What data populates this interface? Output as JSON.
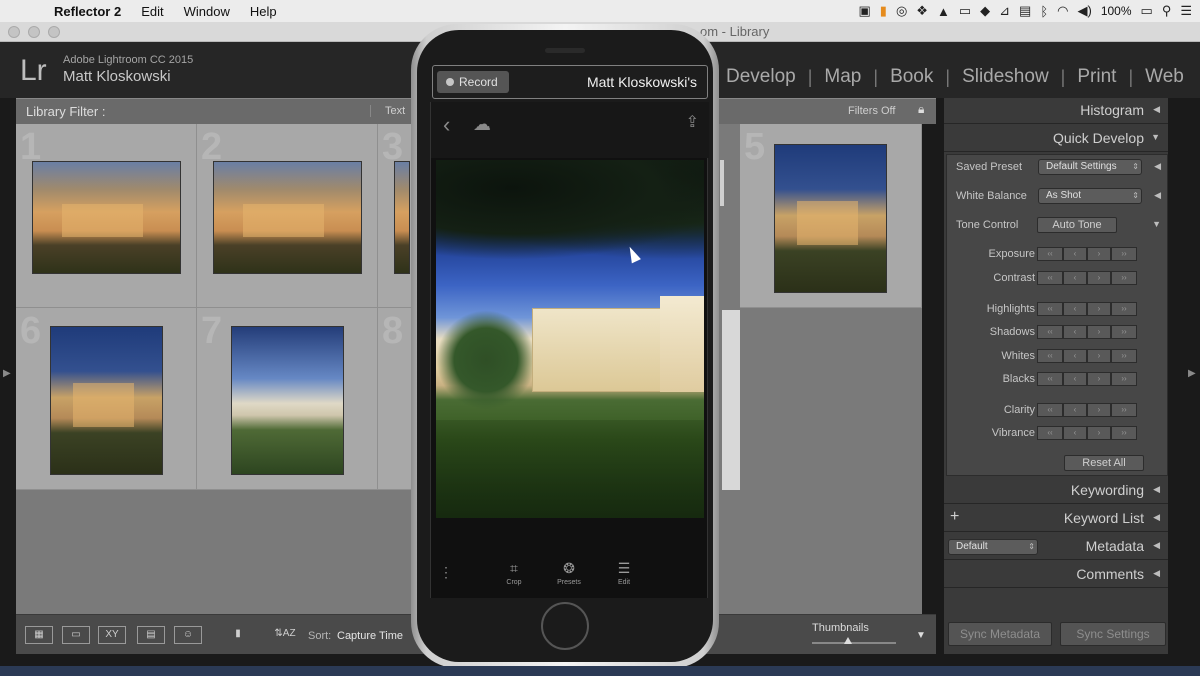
{
  "menubar": {
    "app": "Reflector 2",
    "menus": [
      "Edit",
      "Window",
      "Help"
    ],
    "battery": "100%"
  },
  "window": {
    "title": "om - Library"
  },
  "lightroom": {
    "logo": "Lr",
    "product": "Adobe Lightroom CC 2015",
    "user": "Matt Kloskowski",
    "modules": [
      "Develop",
      "Map",
      "Book",
      "Slideshow",
      "Print",
      "Web"
    ]
  },
  "filter": {
    "label": "Library Filter :",
    "text_tab": "Text",
    "filters_off": "Filters Off"
  },
  "grid": {
    "cell_numbers": [
      "1",
      "2",
      "3",
      "5",
      "6",
      "7",
      "8"
    ]
  },
  "toolbar": {
    "sort_label": "Sort:",
    "sort_value": "Capture Time",
    "thumbnails_label": "Thumbnails",
    "thumbnail_size": 0.45
  },
  "panel": {
    "histogram": "Histogram",
    "quick_develop": "Quick Develop",
    "saved_preset_label": "Saved Preset",
    "saved_preset_value": "Default Settings",
    "white_balance_label": "White Balance",
    "white_balance_value": "As Shot",
    "tone_control_label": "Tone Control",
    "auto_tone": "Auto Tone",
    "adjustments": [
      "Exposure",
      "Contrast",
      "Highlights",
      "Shadows",
      "Whites",
      "Blacks",
      "Clarity",
      "Vibrance"
    ],
    "reset_all": "Reset All",
    "keywording": "Keywording",
    "keyword_list": "Keyword List",
    "metadata_preset": "Default",
    "metadata": "Metadata",
    "comments": "Comments",
    "sync_metadata": "Sync Metadata",
    "sync_settings": "Sync Settings"
  },
  "phone": {
    "record_label": "Record",
    "device_name": "Matt Kloskowski's",
    "tools": [
      "Crop",
      "Presets",
      "Edit"
    ]
  }
}
